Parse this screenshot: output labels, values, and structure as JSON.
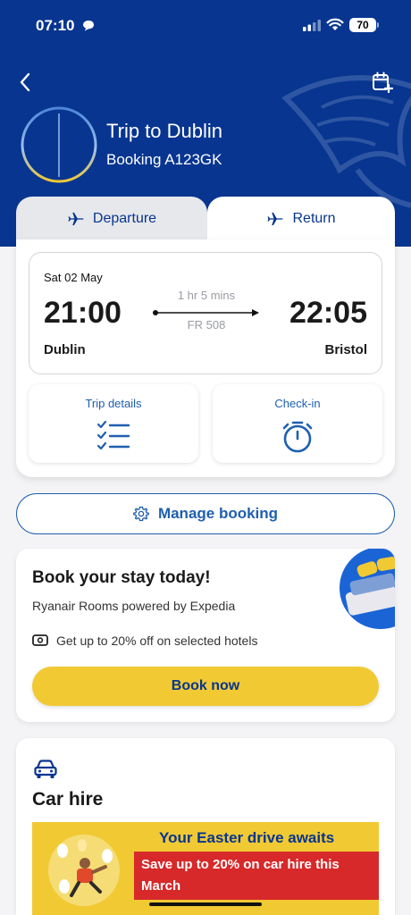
{
  "status_bar": {
    "time": "07:10",
    "battery": "70"
  },
  "trip": {
    "title": "Trip to Dublin",
    "booking": "Booking A123GK"
  },
  "tabs": {
    "departure": "Departure",
    "return": "Return"
  },
  "flight": {
    "date": "Sat 02 May",
    "departure_time": "21:00",
    "arrival_time": "22:05",
    "duration": "1 hr 5 mins",
    "flight_number": "FR 508",
    "from": "Dublin",
    "to": "Bristol"
  },
  "actions": {
    "trip_details": "Trip details",
    "check_in": "Check-in"
  },
  "manage": {
    "label": "Manage booking"
  },
  "stay": {
    "title": "Book your stay today!",
    "subtitle": "Ryanair Rooms powered by Expedia",
    "offer": "Get up to 20% off on selected hotels",
    "button": "Book now"
  },
  "car": {
    "title": "Car hire",
    "banner_headline": "Your Easter drive awaits",
    "banner_offer": "Save up to 20% on car hire this March"
  },
  "colors": {
    "brand_blue": "#073590",
    "accent_yellow": "#f1c933",
    "link_blue": "#1f5fb0",
    "promo_red": "#d7292a"
  },
  "icons": [
    "chat-bubble-icon",
    "signal-icon",
    "wifi-icon",
    "back-arrow-icon",
    "calendar-add-icon",
    "airplane-icon",
    "checklist-icon",
    "stopwatch-icon",
    "gear-icon",
    "cash-icon",
    "car-icon"
  ]
}
